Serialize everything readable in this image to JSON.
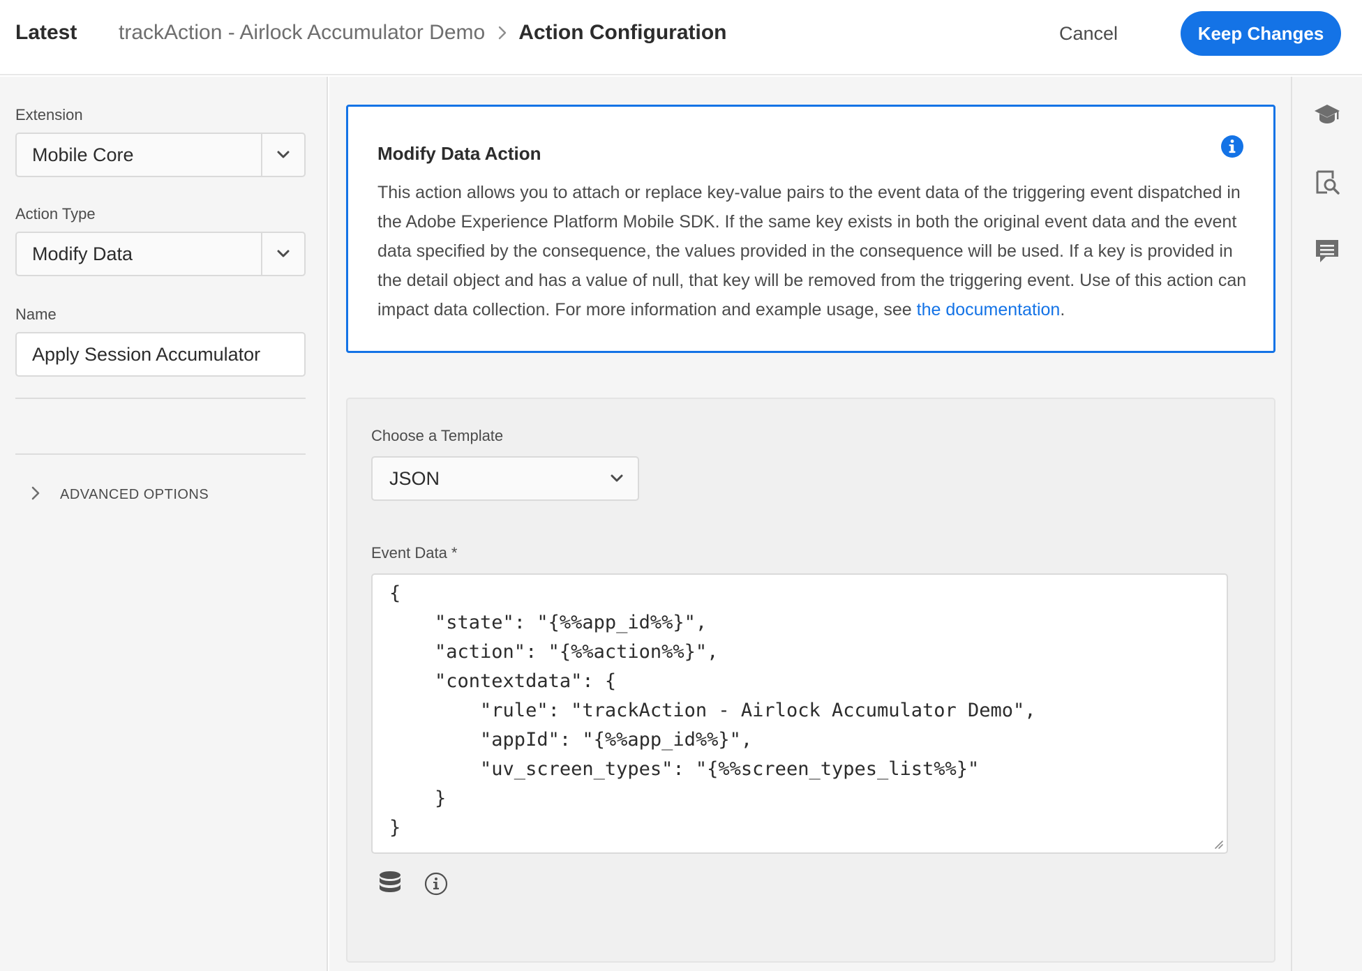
{
  "header": {
    "latest_label": "Latest",
    "breadcrumb": {
      "rule_name": "trackAction - Airlock Accumulator Demo",
      "current": "Action Configuration"
    },
    "cancel_label": "Cancel",
    "keep_label": "Keep Changes"
  },
  "sidebar": {
    "extension_label": "Extension",
    "extension_value": "Mobile Core",
    "action_type_label": "Action Type",
    "action_type_value": "Modify Data",
    "name_label": "Name",
    "name_value": "Apply Session Accumulator",
    "advanced_label": "ADVANCED OPTIONS"
  },
  "info": {
    "title": "Modify Data Action",
    "body": "This action allows you to attach or replace key-value pairs to the event data of the triggering event dispatched in the Adobe Experience Platform Mobile SDK. If the same key exists in both the original event data and the event data specified by the consequence, the values provided in the consequence will be used. If a key is provided in the detail object and has a value of null, that key will be removed from the triggering event. Use of this action can impact data collection. For more information and example usage, see ",
    "link_text": "the documentation",
    "link_suffix": "."
  },
  "panel": {
    "template_label": "Choose a Template",
    "template_value": "JSON",
    "event_data_label": "Event Data",
    "required_marker": "*",
    "code_lines": [
      "{",
      "    \"state\": \"{%%app_id%%}\",",
      "    \"action\": \"{%%action%%}\",",
      "    \"contextdata\": {",
      "        \"rule\": \"trackAction - Airlock Accumulator Demo\",",
      "        \"appId\": \"{%%app_id%%}\",",
      "        \"uv_screen_types\": \"{%%screen_types_list%%}\"",
      "    }",
      "}"
    ]
  },
  "rail": {
    "icons": [
      "learn-icon",
      "preview-icon",
      "comment-icon"
    ]
  },
  "colors": {
    "accent": "#1473e6",
    "panel_bg": "#f5f5f5"
  }
}
